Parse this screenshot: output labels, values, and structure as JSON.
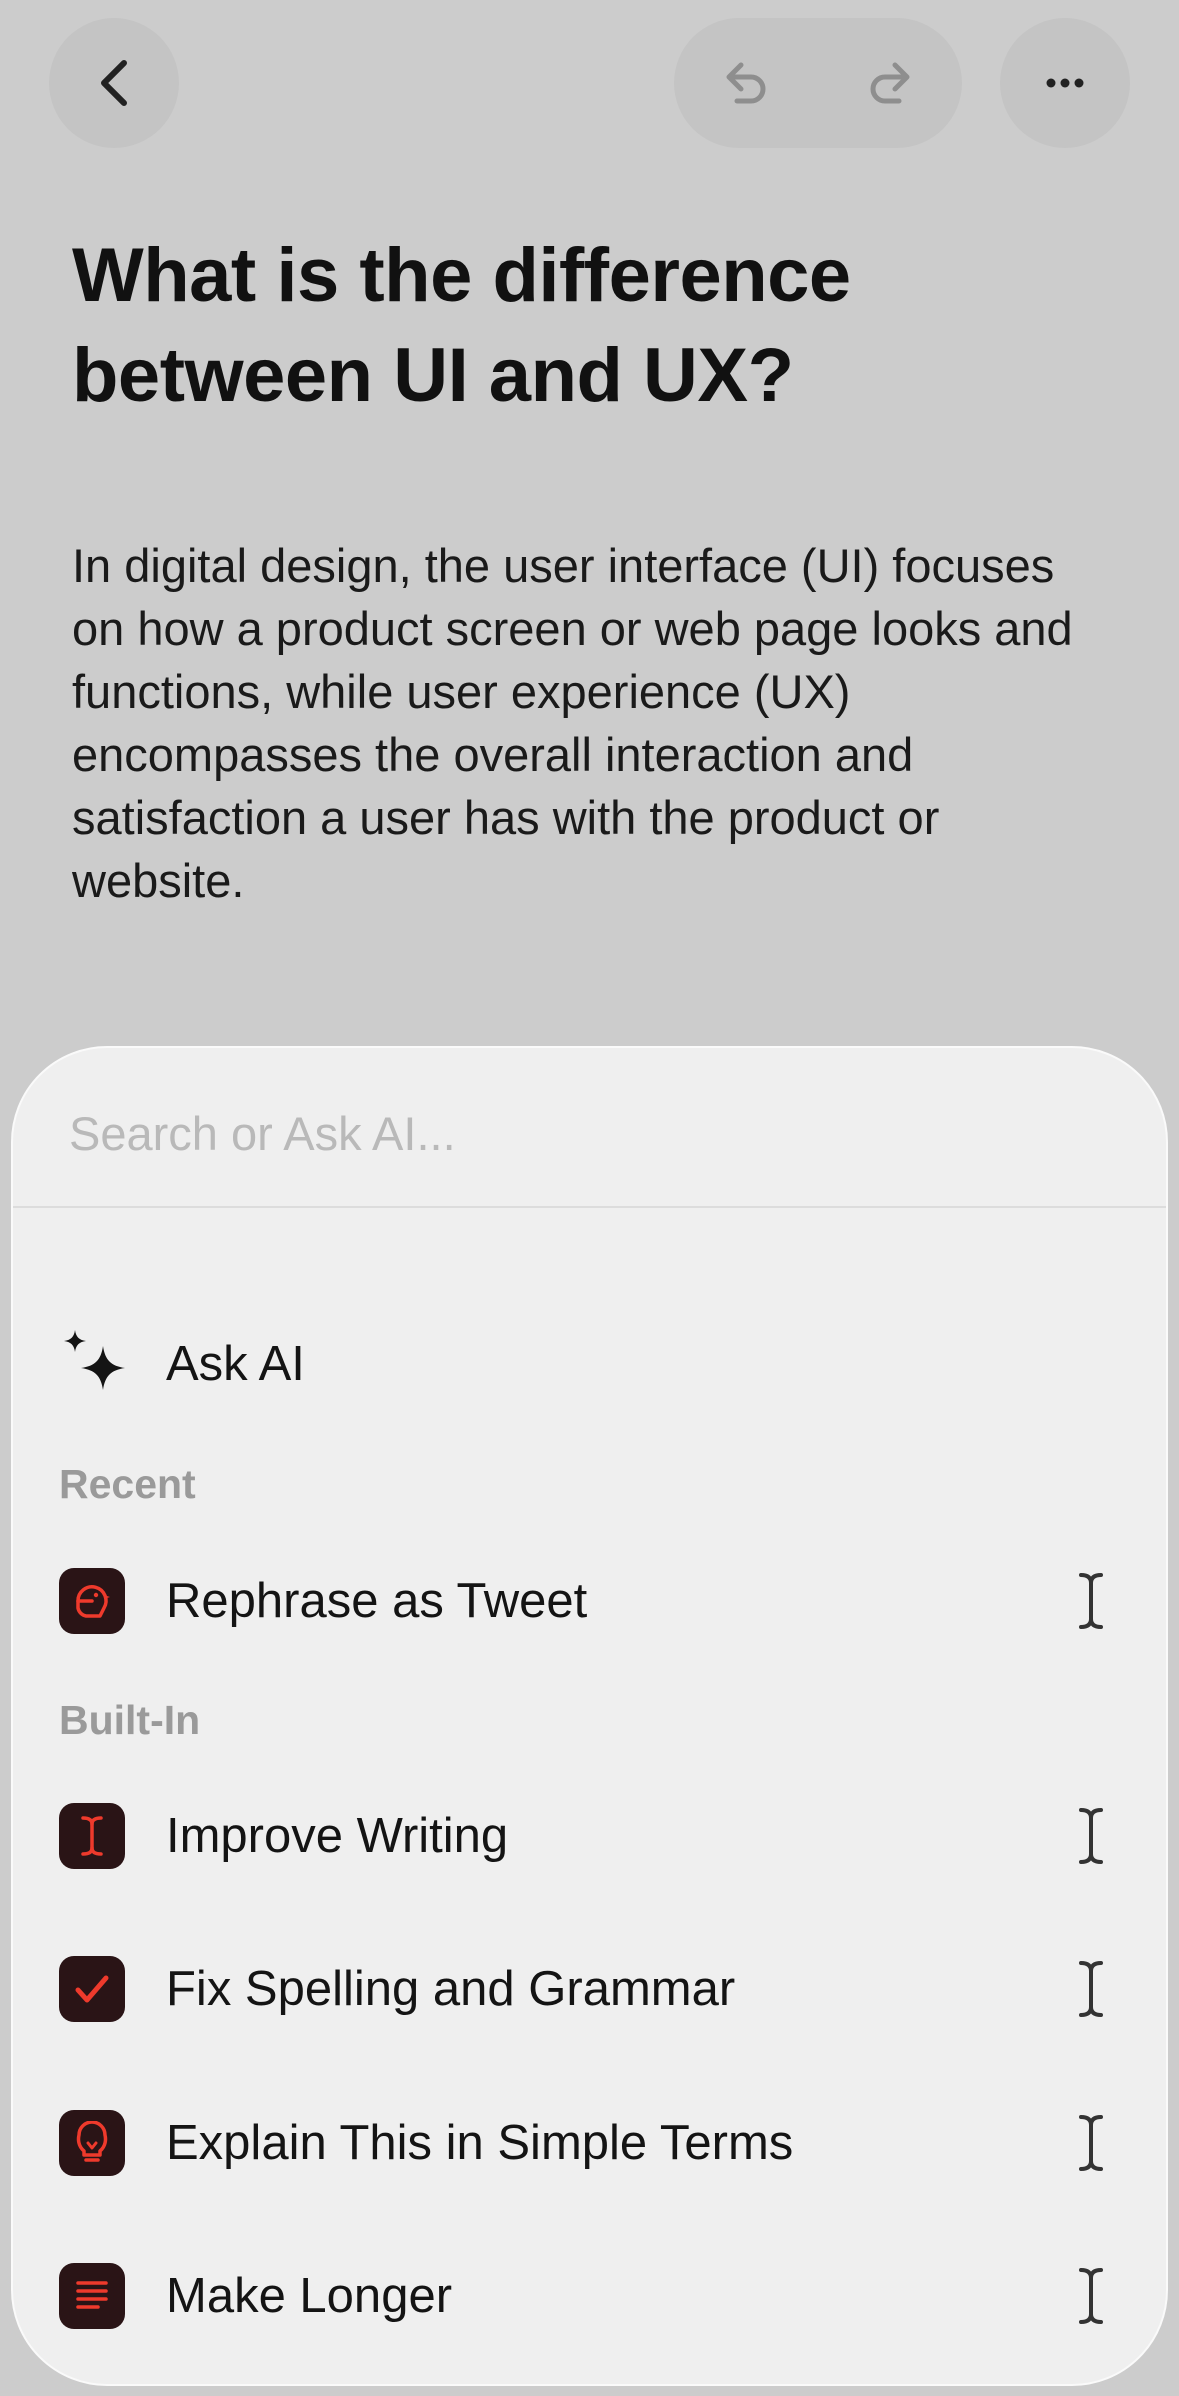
{
  "toolbar": {
    "back_icon": "chevron-left-icon",
    "undo_icon": "undo-icon",
    "redo_icon": "redo-icon",
    "more_icon": "ellipsis-icon"
  },
  "document": {
    "title": "What is the difference between UI and UX?",
    "body": "In digital design, the user interface (UI) focuses on how a product screen or web page looks and functions, while user experience (UX) encompasses the overall interaction and satisfaction a user has with the product or website."
  },
  "sheet": {
    "search": {
      "placeholder": "Search or Ask AI...",
      "value": ""
    },
    "ask_ai": {
      "label": "Ask AI",
      "icon": "sparkles-icon"
    },
    "sections": {
      "recent": {
        "header": "Recent",
        "items": [
          {
            "label": "Rephrase as Tweet",
            "icon": "bird-icon"
          }
        ]
      },
      "built_in": {
        "header": "Built-In",
        "items": [
          {
            "label": "Improve Writing",
            "icon": "text-cursor-icon"
          },
          {
            "label": "Fix Spelling and Grammar",
            "icon": "checkmark-icon"
          },
          {
            "label": "Explain This in Simple Terms",
            "icon": "lightbulb-icon"
          },
          {
            "label": "Make Longer",
            "icon": "text-lines-icon"
          }
        ]
      }
    },
    "row_trailing_icon": "text-cursor-icon"
  },
  "colors": {
    "background": "#cccccc",
    "sheet_background": "#efefef",
    "accent": "#ee3a2c",
    "app_icon_background": "#2a1416",
    "section_header": "#9a9a9a",
    "placeholder": "#b9b9b9"
  }
}
